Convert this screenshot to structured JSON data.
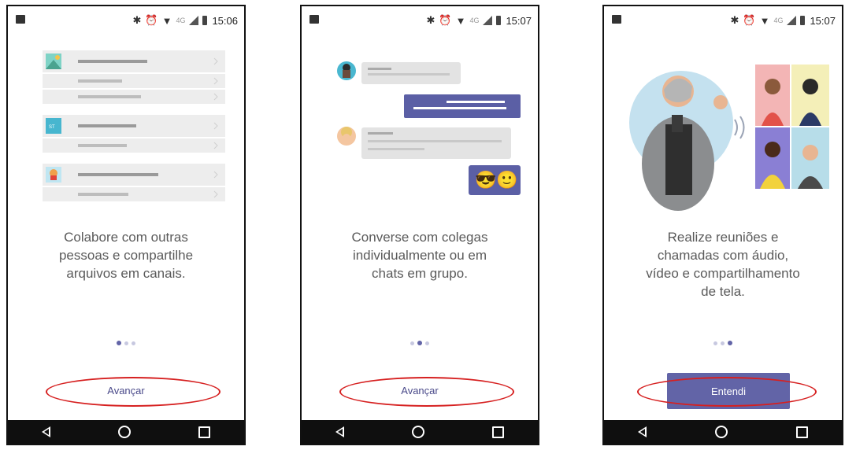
{
  "screens": [
    {
      "status": {
        "time": "15:06",
        "network": "4G"
      },
      "caption_lines": [
        "Colabore com outras",
        "pessoas e compartilhe",
        "arquivos em canais."
      ],
      "avatar_text": "ST",
      "dots_active": 0,
      "button": "Avançar",
      "button_style": "text"
    },
    {
      "status": {
        "time": "15:07",
        "network": "4G"
      },
      "caption_lines": [
        "Converse com colegas",
        "individualmente ou em",
        "chats em grupo."
      ],
      "emoji": "😎🙂",
      "dots_active": 1,
      "button": "Avançar",
      "button_style": "text"
    },
    {
      "status": {
        "time": "15:07",
        "network": "4G"
      },
      "caption_lines": [
        "Realize reuniões e",
        "chamadas com áudio,",
        "vídeo e compartilhamento",
        "de tela."
      ],
      "dots_active": 2,
      "button": "Entendi",
      "button_style": "filled"
    }
  ],
  "colors": {
    "accent": "#6264a7",
    "highlight_ring": "#d62020",
    "navbar": "#0f0f0f"
  },
  "icons": [
    "image-icon",
    "bluetooth-icon",
    "alarm-icon",
    "wifi-icon",
    "signal-icon",
    "battery-icon",
    "back-icon",
    "home-icon",
    "recents-icon"
  ]
}
